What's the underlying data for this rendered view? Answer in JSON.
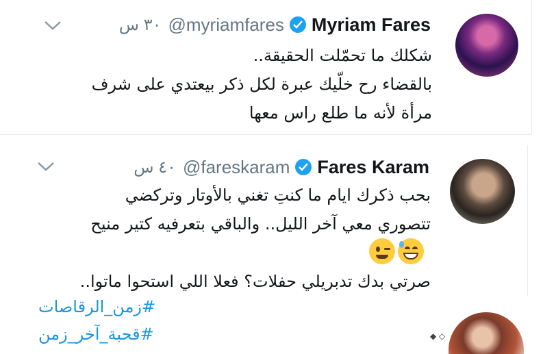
{
  "tweets": [
    {
      "display_name": "Myriam Fares",
      "handle": "@myriamfares",
      "timestamp": "٣٠ س",
      "body_lines": [
        "شكلك ما تحمّلت الحقيقة..",
        "بالقضاء رح خلّيك عبرة لكل ذكر بيعتدي على شرف",
        "مرأة لأنه ما طلع راس معها"
      ],
      "avatar": "avatar-myriam",
      "verified": true
    },
    {
      "display_name": "Fares Karam",
      "handle": "@fareskaram",
      "timestamp": "٤٠ س",
      "body_lines": [
        "بحب ذكرك ايام ما كنتِ تغني بالأوتار وتركضي",
        "تتصوري معي آخر الليل.. والباقي بتعرفيه كتير منيح"
      ],
      "emojis": [
        "winking-face-icon",
        "grinning-sweat-face-icon"
      ],
      "body_lines_after": [
        "صرتي بدك تدبريلي حفلات؟ فعلا اللي استحوا ماتوا.."
      ],
      "hashtags": [
        "#زمن_الرقاصات",
        "#قحبة_آخر_زمن"
      ],
      "avatar": "avatar-fares",
      "verified": true
    }
  ],
  "colors": {
    "verified_badge": "#1da1f2",
    "hashtag": "#1b95e0",
    "meta_text": "#657786",
    "divider": "#e6ecf0"
  }
}
